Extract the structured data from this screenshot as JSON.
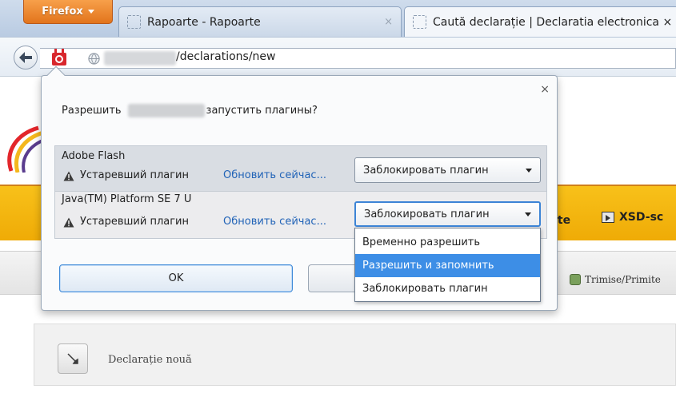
{
  "browser": {
    "menu_button_label": "Firefox",
    "tabs": [
      {
        "title": "Rapoarte - Rapoarte",
        "close": "×"
      },
      {
        "title": "Caută declarație | Declaratia electronica ×"
      }
    ],
    "url_path": "/declarations/new"
  },
  "plugin_panel": {
    "close_glyph": "×",
    "question_prefix": "Разрешить",
    "question_suffix": "запустить плагины?",
    "plugins": [
      {
        "name": "Adobe Flash",
        "status": "Устаревший плагин",
        "update_link": "Обновить сейчас...",
        "action": "Заблокировать плагин"
      },
      {
        "name": "Java(TM) Platform SE 7 U",
        "status": "Устаревший плагин",
        "update_link": "Обновить сейчас...",
        "action": "Заблокировать плагин"
      }
    ],
    "ok_label": "OK",
    "dropdown_options": [
      "Временно разрешить",
      "Разрешить и запомнить",
      "Заблокировать плагин"
    ],
    "dropdown_selected_index": 1
  },
  "page": {
    "partial_tab_label": "rte",
    "xsd_button_label": "XSD-sc",
    "trimise_label": "Trimise/Primite",
    "new_declaration_label": "Declarație nouă"
  },
  "colors": {
    "firefox_orange": "#e2741c",
    "link_blue": "#2163b7",
    "selection_blue": "#3d8ee6",
    "band_yellow": "#f8c11a"
  },
  "icons": [
    "back-arrow-icon",
    "plugin-notice-icon",
    "globe-icon",
    "warning-icon",
    "xsd-icon",
    "trimise-icon",
    "declaration-icon"
  ]
}
